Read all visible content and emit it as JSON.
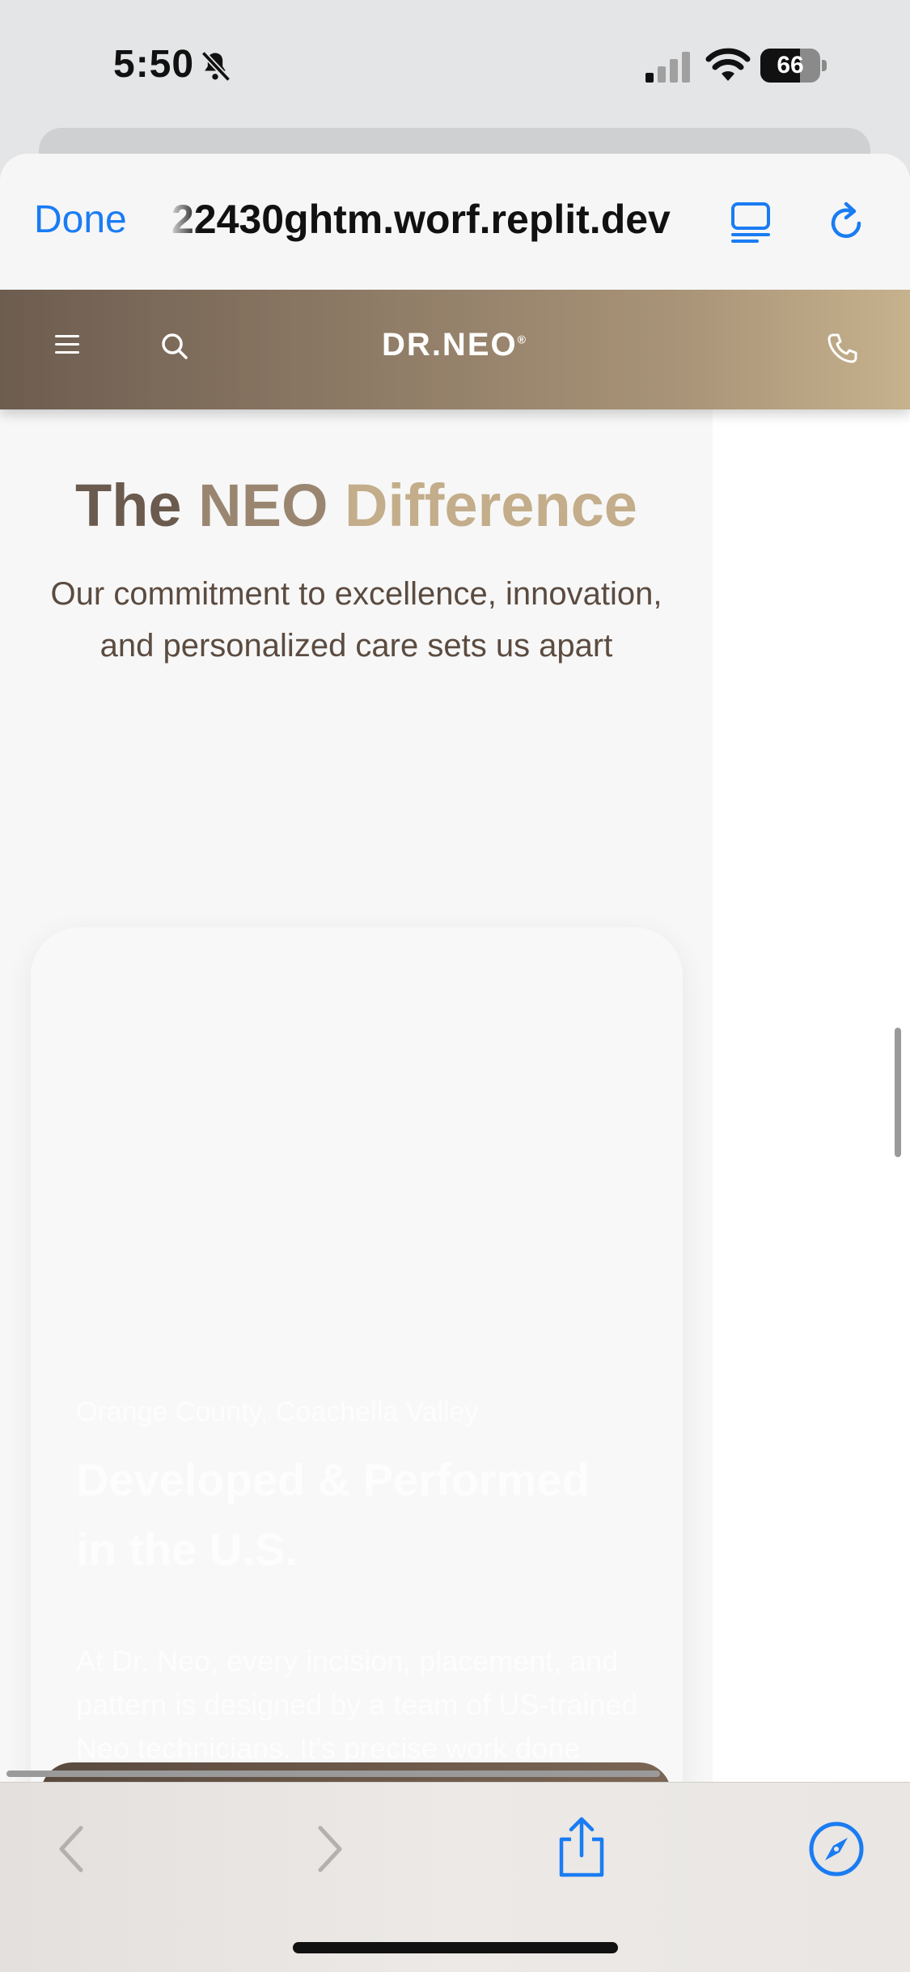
{
  "status_bar": {
    "time": "5:50",
    "battery_level": "66",
    "icons": [
      "bell-slash-icon",
      "cellular-signal-icon",
      "wifi-icon",
      "battery-icon"
    ]
  },
  "browser": {
    "done_label": "Done",
    "url": "22430ghtm.worf.replit.dev",
    "accent_color": "#1a7cf2",
    "icons": [
      "reader-icon",
      "reload-icon"
    ]
  },
  "site_header": {
    "logo_text": "DR.NEO",
    "logo_mark": "®",
    "icons": [
      "hamburger-menu-icon",
      "search-icon",
      "phone-icon"
    ]
  },
  "section": {
    "title_part1": "The ",
    "title_part2": "NEO",
    "title_part3": " Difference",
    "subtitle": "Our commitment to excellence, innovation, and personalized care sets us apart"
  },
  "card": {
    "location": "Orange County, Coachella Valley",
    "title": "Developed & Performed in the U.S.",
    "body": "At Dr. Neo, every incision, placement, and pattern is designed by a team of US-trained Neo technicians. It's precise work done once, done right."
  },
  "toolbar": {
    "icons": [
      "back-arrow-icon",
      "forward-arrow-icon",
      "share-icon",
      "compass-icon"
    ]
  },
  "colors": {
    "brand_dark": "#6b5a4e",
    "brand_gold": "#c3ad8a",
    "body_text": "#5b4b40"
  }
}
